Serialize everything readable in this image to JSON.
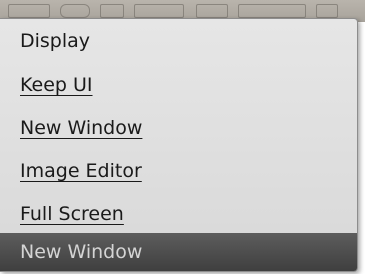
{
  "menu": {
    "title": "Display",
    "items": [
      {
        "label": "Keep UI"
      },
      {
        "label": "New Window"
      },
      {
        "label": "Image Editor"
      },
      {
        "label": "Full Screen"
      }
    ],
    "selected_label": "New Window"
  },
  "colors": {
    "menu_background": "#e0e0e0",
    "selected_background": "#4a4a4a",
    "selected_text": "#d4d4d4",
    "text": "#1a1a1a"
  }
}
